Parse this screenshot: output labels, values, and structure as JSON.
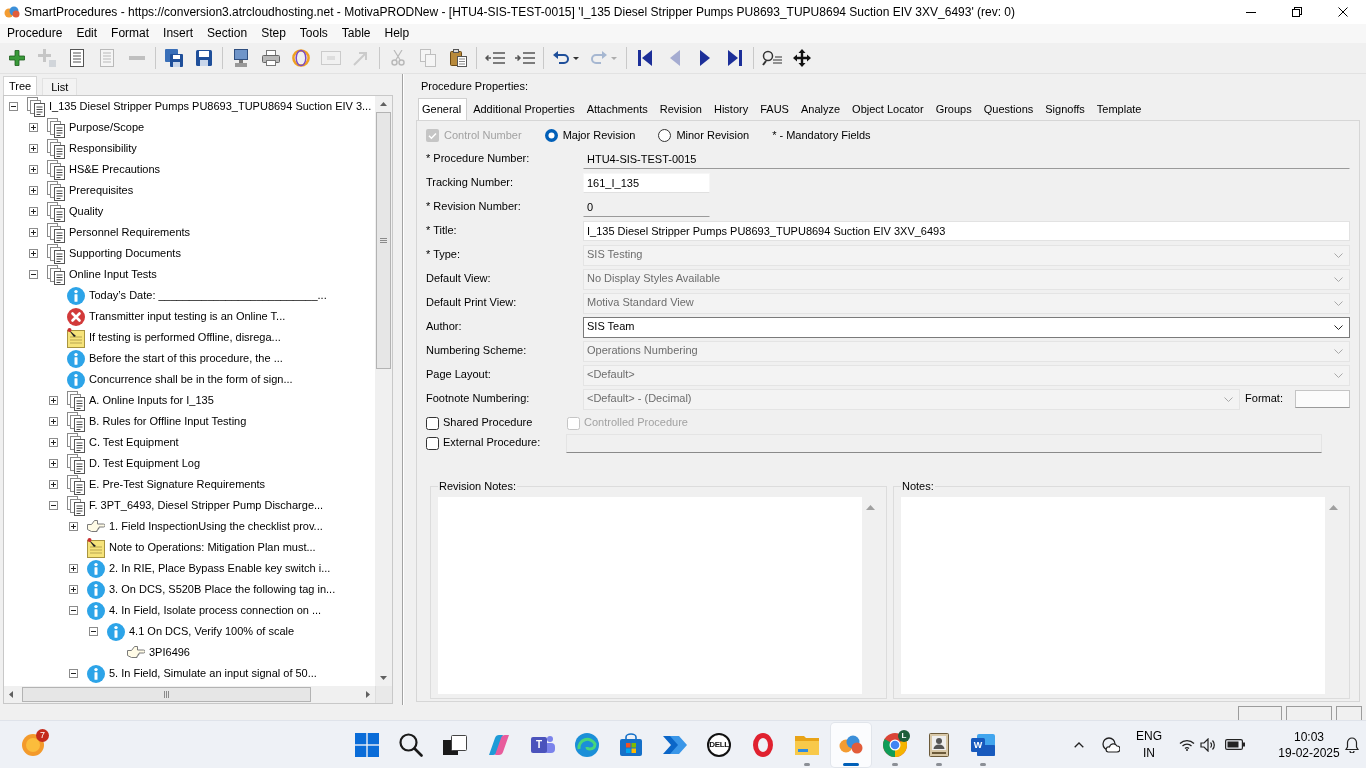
{
  "window": {
    "title": "SmartProcedures - https://conversion3.atrcloudhosting.net - MotivaPRODNew - [HTU4-SIS-TEST-0015] 'I_135 Diesel Stripper Pumps PU8693_TUPU8694 Suction EIV 3XV_6493' (rev: 0)"
  },
  "menu": [
    "Procedure",
    "Edit",
    "Format",
    "Insert",
    "Section",
    "Step",
    "Tools",
    "Table",
    "Help"
  ],
  "toolbar": [
    [
      {
        "disabled": false,
        "dropdown": false
      },
      {
        "disabled": true,
        "dropdown": false
      },
      {
        "disabled": false,
        "dropdown": false
      },
      {
        "disabled": true,
        "dropdown": false
      },
      {
        "disabled": true,
        "dropdown": false
      }
    ],
    [
      {
        "disabled": false,
        "dropdown": false
      },
      {
        "disabled": false,
        "dropdown": false
      }
    ],
    [
      {
        "disabled": false,
        "dropdown": false
      },
      {
        "disabled": false,
        "dropdown": false
      },
      {
        "disabled": false,
        "dropdown": false
      },
      {
        "disabled": true,
        "dropdown": false
      },
      {
        "disabled": true,
        "dropdown": false
      }
    ],
    [
      {
        "disabled": true,
        "dropdown": false
      },
      {
        "disabled": true,
        "dropdown": false
      },
      {
        "disabled": false,
        "dropdown": false
      }
    ],
    [
      {
        "disabled": false,
        "dropdown": false
      },
      {
        "disabled": false,
        "dropdown": false
      }
    ],
    [
      {
        "disabled": false,
        "dropdown": true
      },
      {
        "disabled": true,
        "dropdown": true
      }
    ],
    [
      {
        "disabled": false,
        "dropdown": false
      },
      {
        "disabled": true,
        "dropdown": false
      },
      {
        "disabled": false,
        "dropdown": false
      },
      {
        "disabled": false,
        "dropdown": false
      }
    ],
    [
      {
        "disabled": false,
        "dropdown": false
      },
      {
        "disabled": false,
        "dropdown": false
      }
    ]
  ],
  "tree": {
    "tabs": [
      {
        "label": "Tree",
        "selected": true
      },
      {
        "label": "List",
        "selected": false
      }
    ],
    "nodes": [
      {
        "label": "I_135 Diesel Stripper Pumps PU8693_TUPU8694 Suction EIV 3...",
        "kind": "section",
        "expanded": true,
        "children": [
          {
            "label": "Purpose/Scope",
            "kind": "section",
            "expanded": false
          },
          {
            "label": "Responsibility",
            "kind": "section",
            "expanded": false
          },
          {
            "label": "HS&E Precautions",
            "kind": "section",
            "expanded": false
          },
          {
            "label": "Prerequisites",
            "kind": "section",
            "expanded": false
          },
          {
            "label": "Quality",
            "kind": "section",
            "expanded": false
          },
          {
            "label": "Personnel Requirements",
            "kind": "section",
            "expanded": false
          },
          {
            "label": "Supporting Documents",
            "kind": "section",
            "expanded": false
          },
          {
            "label": "Online Input Tests",
            "kind": "section",
            "expanded": true,
            "children": [
              {
                "label": "Today’s Date: __________________________...",
                "kind": "info"
              },
              {
                "label": "Transmitter input testing is an Online T...",
                "kind": "error"
              },
              {
                "label": "If testing is performed Offline, disrega...",
                "kind": "note"
              },
              {
                "label": "Before the start of this procedure, the ...",
                "kind": "info"
              },
              {
                "label": "Concurrence shall be in the form of sign...",
                "kind": "info"
              },
              {
                "label": "A. Online Inputs for I_135",
                "kind": "section",
                "expanded": false
              },
              {
                "label": "B. Rules for Offline Input Testing",
                "kind": "section",
                "expanded": false
              },
              {
                "label": "C. Test Equipment",
                "kind": "section",
                "expanded": false
              },
              {
                "label": "D. Test Equipment Log",
                "kind": "section",
                "expanded": false
              },
              {
                "label": "E. Pre-Test Signature Requirements",
                "kind": "section",
                "expanded": false
              },
              {
                "label": "F. 3PT_6493, Diesel Stripper Pump Discharge...",
                "kind": "section",
                "expanded": true,
                "children": [
                  {
                    "label": "1. Field InspectionUsing the checklist prov...",
                    "kind": "hand",
                    "expanded": false
                  },
                  {
                    "label": "Note to Operations: Mitigation Plan must...",
                    "kind": "note"
                  },
                  {
                    "label": "2. In RIE, Place Bypass Enable key switch i...",
                    "kind": "info",
                    "expanded": false
                  },
                  {
                    "label": "3. On DCS, S520B Place the following tag in...",
                    "kind": "info",
                    "expanded": false
                  },
                  {
                    "label": "4. In Field, Isolate process connection on ...",
                    "kind": "info",
                    "expanded": true,
                    "children": [
                      {
                        "label": "4.1 On DCS, Verify 100% of scale",
                        "kind": "info",
                        "expanded": true,
                        "children": [
                          {
                            "label": "3PI6496",
                            "kind": "hand"
                          }
                        ]
                      }
                    ]
                  },
                  {
                    "label": "5. In Field, Simulate an input signal of 50...",
                    "kind": "info",
                    "expanded": true
                  }
                ]
              }
            ]
          }
        ]
      }
    ]
  },
  "properties": {
    "heading": "Procedure Properties:",
    "tabs": [
      {
        "label": "General",
        "selected": true
      },
      {
        "label": "Additional Properties",
        "selected": false
      },
      {
        "label": "Attachments",
        "selected": false
      },
      {
        "label": "Revision",
        "selected": false
      },
      {
        "label": "History",
        "selected": false
      },
      {
        "label": "FAUS",
        "selected": false
      },
      {
        "label": "Analyze",
        "selected": false
      },
      {
        "label": "Object Locator",
        "selected": false
      },
      {
        "label": "Groups",
        "selected": false
      },
      {
        "label": "Questions",
        "selected": false
      },
      {
        "label": "Signoffs",
        "selected": false
      },
      {
        "label": "Template",
        "selected": false
      }
    ],
    "options": [
      {
        "kind": "checkbox",
        "label": "Control Number",
        "checked": true,
        "disabled": true
      },
      {
        "kind": "radio",
        "label": "Major Revision",
        "selected": true
      },
      {
        "kind": "radio",
        "label": "Minor Revision",
        "selected": false
      },
      {
        "kind": "note",
        "label": "* - Mandatory Fields"
      }
    ],
    "fields": [
      {
        "label": "* Procedure Number:",
        "kind": "display",
        "value": "HTU4-SIS-TEST-0015"
      },
      {
        "label": "Tracking Number:",
        "kind": "code",
        "value": "161_I_135"
      },
      {
        "label": "* Revision Number:",
        "kind": "number",
        "value": "0"
      },
      {
        "label": "* Title:",
        "kind": "text",
        "value": "I_135 Diesel Stripper Pumps PU8693_TUPU8694 Suction EIV 3XV_6493"
      },
      {
        "label": "* Type:",
        "kind": "select",
        "disabled": true,
        "value": "SIS Testing"
      },
      {
        "label": "Default View:",
        "kind": "select",
        "disabled": true,
        "value": "No Display Styles Available"
      },
      {
        "label": "Default Print View:",
        "kind": "select",
        "disabled": true,
        "value": "Motiva Standard View"
      },
      {
        "label": "Author:",
        "kind": "select",
        "disabled": false,
        "value": "SIS Team"
      },
      {
        "label": "Numbering Scheme:",
        "kind": "select",
        "disabled": true,
        "value": "Operations Numbering"
      },
      {
        "label": "Page Layout:",
        "kind": "select",
        "disabled": true,
        "value": "<Default>"
      },
      {
        "label": "Footnote Numbering:",
        "kind": "select",
        "disabled": true,
        "value": "<Default> - (Decimal)",
        "format": {
          "label": "Format:"
        }
      }
    ],
    "checks": [
      {
        "label": "Shared Procedure",
        "checked": false,
        "disabled": false,
        "extra": {
          "kind": "checkbox",
          "label": "Controlled Procedure",
          "checked": false,
          "disabled": true
        }
      },
      {
        "label": "External Procedure:",
        "checked": false,
        "disabled": false,
        "extra": {
          "kind": "field",
          "disabled": true
        }
      }
    ],
    "notes": [
      {
        "label": "Revision Notes:"
      },
      {
        "label": "Notes:"
      }
    ]
  },
  "taskbar": {
    "widget": {
      "badge": "7"
    },
    "apps": [
      {
        "running": false,
        "selected": false
      },
      {
        "running": false,
        "selected": false
      },
      {
        "running": false,
        "selected": false
      },
      {
        "running": false,
        "selected": false
      },
      {
        "running": false,
        "selected": false,
        "text": "T"
      },
      {
        "running": false,
        "selected": false
      },
      {
        "running": false,
        "selected": false
      },
      {
        "running": false,
        "selected": false
      },
      {
        "running": false,
        "selected": false,
        "text": "DELL"
      },
      {
        "running": false,
        "selected": false
      },
      {
        "running": true,
        "selected": false
      },
      {
        "running": true,
        "selected": true
      },
      {
        "running": true,
        "selected": false,
        "badge": "L"
      },
      {
        "running": true,
        "selected": false
      },
      {
        "running": true,
        "selected": false,
        "text": "W"
      }
    ],
    "tray": {
      "language": [
        "ENG",
        "IN"
      ],
      "time": "10:03",
      "date": "19-02-2025"
    }
  }
}
